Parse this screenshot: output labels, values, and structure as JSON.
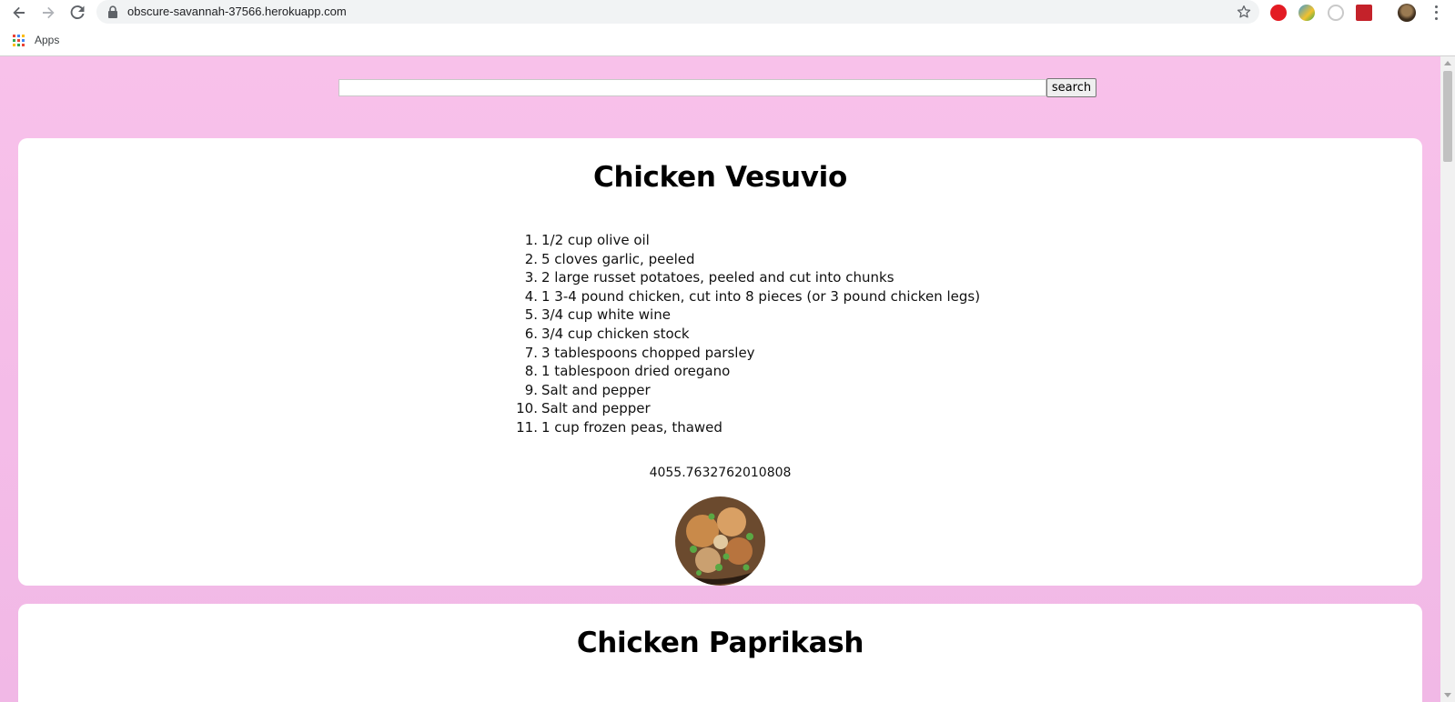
{
  "browser": {
    "url": "obscure-savannah-37566.herokuapp.com",
    "bookmarks": {
      "apps_label": "Apps"
    }
  },
  "search": {
    "value": "",
    "button_label": "search"
  },
  "recipes": [
    {
      "title": "Chicken Vesuvio",
      "ingredients": [
        "1/2 cup olive oil",
        "5 cloves garlic, peeled",
        "2 large russet potatoes, peeled and cut into chunks",
        "1 3-4 pound chicken, cut into 8 pieces (or 3 pound chicken legs)",
        "3/4 cup white wine",
        "3/4 cup chicken stock",
        "3 tablespoons chopped parsley",
        "1 tablespoon dried oregano",
        "Salt and pepper",
        "Salt and pepper",
        "1 cup frozen peas, thawed"
      ],
      "calories": "4055.7632762010808"
    },
    {
      "title": "Chicken Paprikash"
    }
  ],
  "colors": {
    "page_background": "#f8c1ea",
    "card_background": "#ffffff"
  },
  "icons": {
    "back": "arrow-left-icon",
    "forward": "arrow-right-icon",
    "reload": "reload-icon",
    "secure": "lock-icon",
    "bookmark": "star-icon",
    "menu": "kebab-menu-icon"
  }
}
